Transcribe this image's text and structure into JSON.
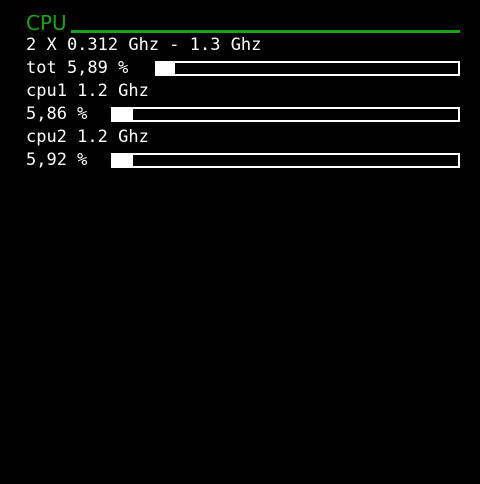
{
  "cpu": {
    "title": "CPU",
    "accent_color": "#1aa31a",
    "freq_summary": "2 X 0.312 Ghz - 1.3 Ghz",
    "total": {
      "label": "tot 5,89 %",
      "percent": 5.89
    },
    "cores": [
      {
        "freq_label": "cpu1 1.2 Ghz",
        "usage_label": "5,86 %",
        "percent": 5.86
      },
      {
        "freq_label": "cpu2 1.2 Ghz",
        "usage_label": "5,92 %",
        "percent": 5.92
      }
    ]
  }
}
